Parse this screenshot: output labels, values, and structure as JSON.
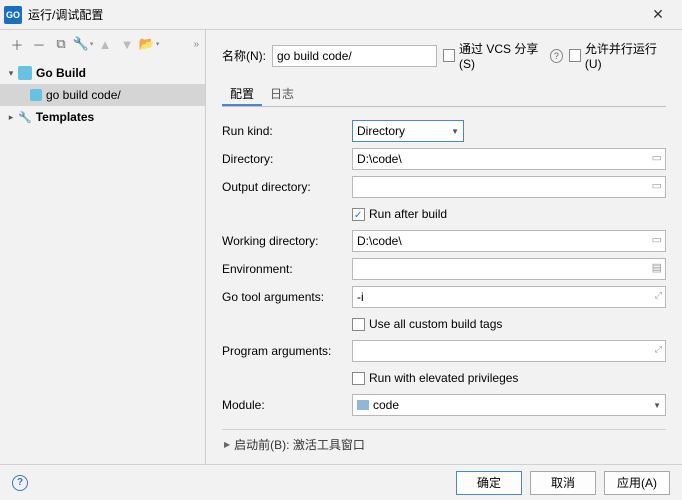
{
  "window": {
    "app_icon_text": "GO",
    "title": "运行/调试配置",
    "close": "✕"
  },
  "left_toolbar": {
    "add": "＋",
    "remove": "－",
    "copy": "⧉",
    "edit": "🔧",
    "up": "▲",
    "down": "▼",
    "folder": "📂"
  },
  "tree": {
    "root1_label": "Go Build",
    "root1_child_label": "go build code/",
    "root2_label": "Templates"
  },
  "name_row": {
    "label": "名称(N):",
    "value": "go build code/",
    "share_label": "通过 VCS 分享(S)",
    "parallel_label": "允许并行运行(U)"
  },
  "tabs": {
    "config": "配置",
    "log": "日志"
  },
  "form": {
    "run_kind_label": "Run kind:",
    "run_kind_value": "Directory",
    "directory_label": "Directory:",
    "directory_value": "D:\\code\\",
    "output_dir_label": "Output directory:",
    "run_after_build_label": "Run after build",
    "working_dir_label": "Working directory:",
    "working_dir_value": "D:\\code\\",
    "env_label": "Environment:",
    "go_args_label": "Go tool arguments:",
    "go_args_value": "-i",
    "custom_tags_label": "Use all custom build tags",
    "prog_args_label": "Program arguments:",
    "elevated_label": "Run with elevated privileges",
    "module_label": "Module:",
    "module_value": "code"
  },
  "before_launch": {
    "label": "启动前(B): 激活工具窗口"
  },
  "buttons": {
    "ok": "确定",
    "cancel": "取消",
    "apply": "应用(A)"
  }
}
